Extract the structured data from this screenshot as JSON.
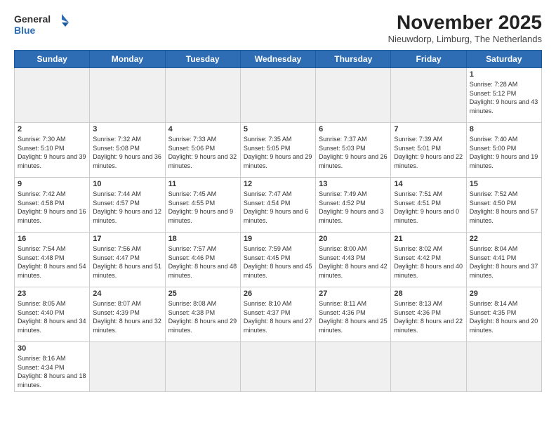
{
  "logo": {
    "text_general": "General",
    "text_blue": "Blue"
  },
  "title": "November 2025",
  "subtitle": "Nieuwdorp, Limburg, The Netherlands",
  "headers": [
    "Sunday",
    "Monday",
    "Tuesday",
    "Wednesday",
    "Thursday",
    "Friday",
    "Saturday"
  ],
  "weeks": [
    [
      {
        "day": "",
        "info": "",
        "empty": true
      },
      {
        "day": "",
        "info": "",
        "empty": true
      },
      {
        "day": "",
        "info": "",
        "empty": true
      },
      {
        "day": "",
        "info": "",
        "empty": true
      },
      {
        "day": "",
        "info": "",
        "empty": true
      },
      {
        "day": "",
        "info": "",
        "empty": true
      },
      {
        "day": "1",
        "info": "Sunrise: 7:28 AM\nSunset: 5:12 PM\nDaylight: 9 hours and 43 minutes."
      }
    ],
    [
      {
        "day": "2",
        "info": "Sunrise: 7:30 AM\nSunset: 5:10 PM\nDaylight: 9 hours and 39 minutes."
      },
      {
        "day": "3",
        "info": "Sunrise: 7:32 AM\nSunset: 5:08 PM\nDaylight: 9 hours and 36 minutes."
      },
      {
        "day": "4",
        "info": "Sunrise: 7:33 AM\nSunset: 5:06 PM\nDaylight: 9 hours and 32 minutes."
      },
      {
        "day": "5",
        "info": "Sunrise: 7:35 AM\nSunset: 5:05 PM\nDaylight: 9 hours and 29 minutes."
      },
      {
        "day": "6",
        "info": "Sunrise: 7:37 AM\nSunset: 5:03 PM\nDaylight: 9 hours and 26 minutes."
      },
      {
        "day": "7",
        "info": "Sunrise: 7:39 AM\nSunset: 5:01 PM\nDaylight: 9 hours and 22 minutes."
      },
      {
        "day": "8",
        "info": "Sunrise: 7:40 AM\nSunset: 5:00 PM\nDaylight: 9 hours and 19 minutes."
      }
    ],
    [
      {
        "day": "9",
        "info": "Sunrise: 7:42 AM\nSunset: 4:58 PM\nDaylight: 9 hours and 16 minutes."
      },
      {
        "day": "10",
        "info": "Sunrise: 7:44 AM\nSunset: 4:57 PM\nDaylight: 9 hours and 12 minutes."
      },
      {
        "day": "11",
        "info": "Sunrise: 7:45 AM\nSunset: 4:55 PM\nDaylight: 9 hours and 9 minutes."
      },
      {
        "day": "12",
        "info": "Sunrise: 7:47 AM\nSunset: 4:54 PM\nDaylight: 9 hours and 6 minutes."
      },
      {
        "day": "13",
        "info": "Sunrise: 7:49 AM\nSunset: 4:52 PM\nDaylight: 9 hours and 3 minutes."
      },
      {
        "day": "14",
        "info": "Sunrise: 7:51 AM\nSunset: 4:51 PM\nDaylight: 9 hours and 0 minutes."
      },
      {
        "day": "15",
        "info": "Sunrise: 7:52 AM\nSunset: 4:50 PM\nDaylight: 8 hours and 57 minutes."
      }
    ],
    [
      {
        "day": "16",
        "info": "Sunrise: 7:54 AM\nSunset: 4:48 PM\nDaylight: 8 hours and 54 minutes."
      },
      {
        "day": "17",
        "info": "Sunrise: 7:56 AM\nSunset: 4:47 PM\nDaylight: 8 hours and 51 minutes."
      },
      {
        "day": "18",
        "info": "Sunrise: 7:57 AM\nSunset: 4:46 PM\nDaylight: 8 hours and 48 minutes."
      },
      {
        "day": "19",
        "info": "Sunrise: 7:59 AM\nSunset: 4:45 PM\nDaylight: 8 hours and 45 minutes."
      },
      {
        "day": "20",
        "info": "Sunrise: 8:00 AM\nSunset: 4:43 PM\nDaylight: 8 hours and 42 minutes."
      },
      {
        "day": "21",
        "info": "Sunrise: 8:02 AM\nSunset: 4:42 PM\nDaylight: 8 hours and 40 minutes."
      },
      {
        "day": "22",
        "info": "Sunrise: 8:04 AM\nSunset: 4:41 PM\nDaylight: 8 hours and 37 minutes."
      }
    ],
    [
      {
        "day": "23",
        "info": "Sunrise: 8:05 AM\nSunset: 4:40 PM\nDaylight: 8 hours and 34 minutes."
      },
      {
        "day": "24",
        "info": "Sunrise: 8:07 AM\nSunset: 4:39 PM\nDaylight: 8 hours and 32 minutes."
      },
      {
        "day": "25",
        "info": "Sunrise: 8:08 AM\nSunset: 4:38 PM\nDaylight: 8 hours and 29 minutes."
      },
      {
        "day": "26",
        "info": "Sunrise: 8:10 AM\nSunset: 4:37 PM\nDaylight: 8 hours and 27 minutes."
      },
      {
        "day": "27",
        "info": "Sunrise: 8:11 AM\nSunset: 4:36 PM\nDaylight: 8 hours and 25 minutes."
      },
      {
        "day": "28",
        "info": "Sunrise: 8:13 AM\nSunset: 4:36 PM\nDaylight: 8 hours and 22 minutes."
      },
      {
        "day": "29",
        "info": "Sunrise: 8:14 AM\nSunset: 4:35 PM\nDaylight: 8 hours and 20 minutes."
      }
    ],
    [
      {
        "day": "30",
        "info": "Sunrise: 8:16 AM\nSunset: 4:34 PM\nDaylight: 8 hours and 18 minutes.",
        "last": true
      },
      {
        "day": "",
        "info": "",
        "empty": true,
        "last": true
      },
      {
        "day": "",
        "info": "",
        "empty": true,
        "last": true
      },
      {
        "day": "",
        "info": "",
        "empty": true,
        "last": true
      },
      {
        "day": "",
        "info": "",
        "empty": true,
        "last": true
      },
      {
        "day": "",
        "info": "",
        "empty": true,
        "last": true
      },
      {
        "day": "",
        "info": "",
        "empty": true,
        "last": true
      }
    ]
  ]
}
